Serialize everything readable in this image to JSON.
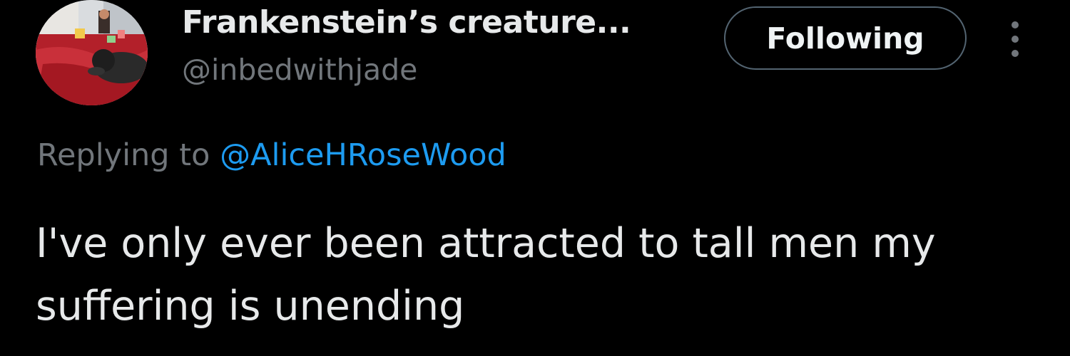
{
  "tweet": {
    "author": {
      "display_name": "Frankenstein’s creature...",
      "handle": "@inbedwithjade",
      "avatar_icon": "profile-photo-avatar"
    },
    "follow_button_label": "Following",
    "more_icon": "more-vertical-icon",
    "reply": {
      "prefix": "Replying to",
      "mention": "@AliceHRoseWood"
    },
    "text": "I've only ever been attracted to tall men my suffering is unending"
  },
  "colors": {
    "background": "#000000",
    "primary_text": "#e7e9ea",
    "secondary_text": "#71767b",
    "link": "#1d9bf0",
    "button_border": "#536471"
  }
}
